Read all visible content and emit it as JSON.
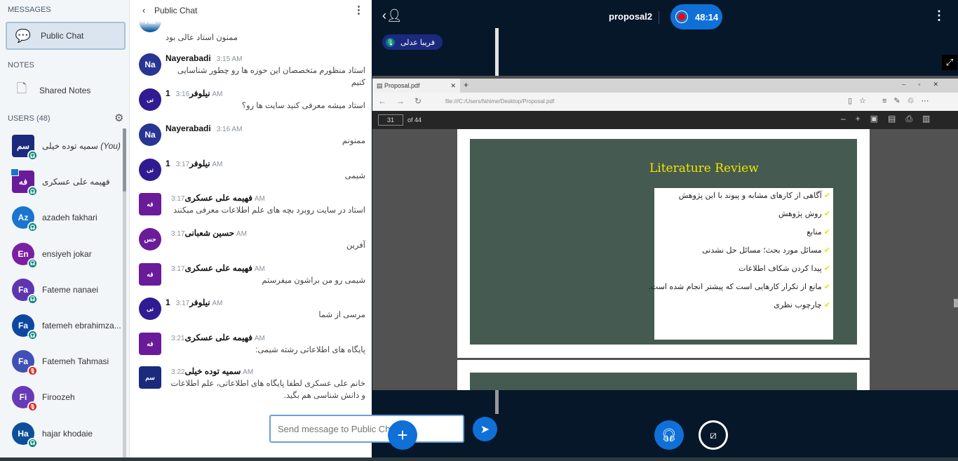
{
  "sidebar": {
    "messages_heading": "MESSAGES",
    "public_chat": "Public Chat",
    "notes_heading": "NOTES",
    "shared_notes": "Shared Notes",
    "users_heading": "USERS (48)",
    "users": [
      {
        "initials": "سم",
        "name": "سمیه توده خیلی",
        "you": "(You)",
        "color": "#1b2a7d",
        "square": true,
        "status": "listen"
      },
      {
        "initials": "فه",
        "name": "فهیمه علی عسکری",
        "color": "#6a1b9a",
        "square": true,
        "status": "listen",
        "presenter": true
      },
      {
        "initials": "Az",
        "name": "azadeh fakhari",
        "color": "#1b75d0",
        "status": "listen"
      },
      {
        "initials": "En",
        "name": "ensiyeh jokar",
        "color": "#7b1fa2",
        "status": "listen"
      },
      {
        "initials": "Fa",
        "name": "Fateme nanaei",
        "color": "#5e35b1",
        "status": "listen"
      },
      {
        "initials": "Fa",
        "name": "fatemeh ebrahimza...",
        "color": "#0d47a1",
        "status": "listen"
      },
      {
        "initials": "Fa",
        "name": "Fatemeh Tahmasi",
        "color": "#3f51b5",
        "status": "muted"
      },
      {
        "initials": "Fi",
        "name": "Firoozeh",
        "color": "#673ab7",
        "status": "muted"
      },
      {
        "initials": "Ha",
        "name": "hajar khodaie",
        "color": "#0d4f9a",
        "status": "listen"
      }
    ]
  },
  "chat": {
    "title": "Public Chat",
    "placeholder": "Send message to Public Chat",
    "partial_message": "ممنون استاد عالی بود",
    "partial_initials": "Ha",
    "messages": [
      {
        "initials": "Na",
        "name": "Nayerabadi",
        "time": "3:15 AM",
        "text": "استاد منظورم متخصصان این حوزه ها رو چطور شناسایی کنیم",
        "color": "#283593"
      },
      {
        "initials": "نی",
        "name": "نیلوفر1",
        "time": "3:16 AM",
        "text": "استاد میشه معرفی کنید سایت ها رو؟",
        "color": "#311b92"
      },
      {
        "initials": "Na",
        "name": "Nayerabadi",
        "time": "3:16 AM",
        "text": "ممنونم",
        "color": "#283593"
      },
      {
        "initials": "نی",
        "name": "نیلوفر1",
        "time": "3:17 AM",
        "text": "شیمی",
        "color": "#311b92"
      },
      {
        "initials": "فه",
        "name": "فهیمه علی عسکری",
        "time": "3:17 AM",
        "text": "استاد در سایت روبرد بچه های علم اطلاعات معرفی میکنند",
        "color": "#6a1b9a",
        "square": true
      },
      {
        "initials": "حس",
        "name": "حسین شعبانی",
        "time": "3:17 AM",
        "text": "آفرین",
        "color": "#6a1b9a"
      },
      {
        "initials": "فه",
        "name": "فهیمه علی عسکری",
        "time": "3:17 AM",
        "text": "شیمی رو من براشون میفرستم",
        "color": "#6a1b9a",
        "square": true
      },
      {
        "initials": "نی",
        "name": "نیلوفر1",
        "time": "3:17 AM",
        "text": "مرسی از شما",
        "color": "#311b92"
      },
      {
        "initials": "فه",
        "name": "فهیمه علی عسکری",
        "time": "3:21 AM",
        "text": "پایگاه های اطلاعاتی رشته شیمی:",
        "color": "#6a1b9a",
        "square": true
      },
      {
        "initials": "سم",
        "name": "سمیه توده خیلی",
        "time": "3:22 AM",
        "text": "خانم علی عسکری لطفا پایگاه های اطلاعاتی، علم اطلاعات و دانش شناسی هم بگید.",
        "color": "#1b2a7d",
        "square": true
      }
    ]
  },
  "header": {
    "meeting": "proposal2",
    "timer": "48:14",
    "talker": "فریبا عدلی"
  },
  "browser": {
    "tab": "Proposal.pdf",
    "url": "file:///C:/Users/fahime/Desktop/Proposal.pdf",
    "page": "31",
    "of": "of 44"
  },
  "slide": {
    "title": "Literature Review",
    "items": [
      "آگاهی از کارهای مشابه و پیوند با این پژوهش",
      "روش پژوهش",
      "منابع",
      "مسائل مورد بحث؛ مسائل حل نشدنی",
      "پیدا کردن شکاف اطلاعات",
      "مانع از تکرار کارهایی است که پیشتر انجام شده است.",
      "چارچوب نظری"
    ]
  },
  "colors": {
    "accent": "#0f70d7",
    "dark_bg": "#06172a",
    "slide_bg": "#455a50",
    "slide_title": "#f2e600"
  }
}
